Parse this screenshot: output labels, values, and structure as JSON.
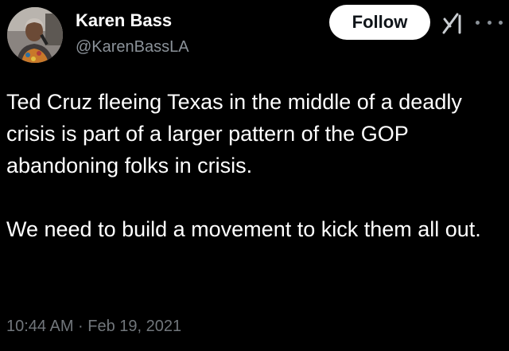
{
  "author": {
    "display_name": "Karen Bass",
    "handle": "@KarenBassLA"
  },
  "actions": {
    "follow_label": "Follow"
  },
  "icons": {
    "logo": "grok-icon",
    "more": "more-options-icon"
  },
  "tweet": {
    "paragraphs": [
      "Ted Cruz fleeing Texas in the middle of a deadly crisis is part of a larger pattern of the GOP abandoning folks in crisis.",
      "We need to build a movement to kick them all out."
    ],
    "timestamp": "10:44 AM · Feb 19, 2021"
  },
  "colors": {
    "background": "#000000",
    "text": "#ffffff",
    "secondary_text": "#8b9299",
    "follow_bg": "#ffffff",
    "follow_text": "#0f1419"
  }
}
